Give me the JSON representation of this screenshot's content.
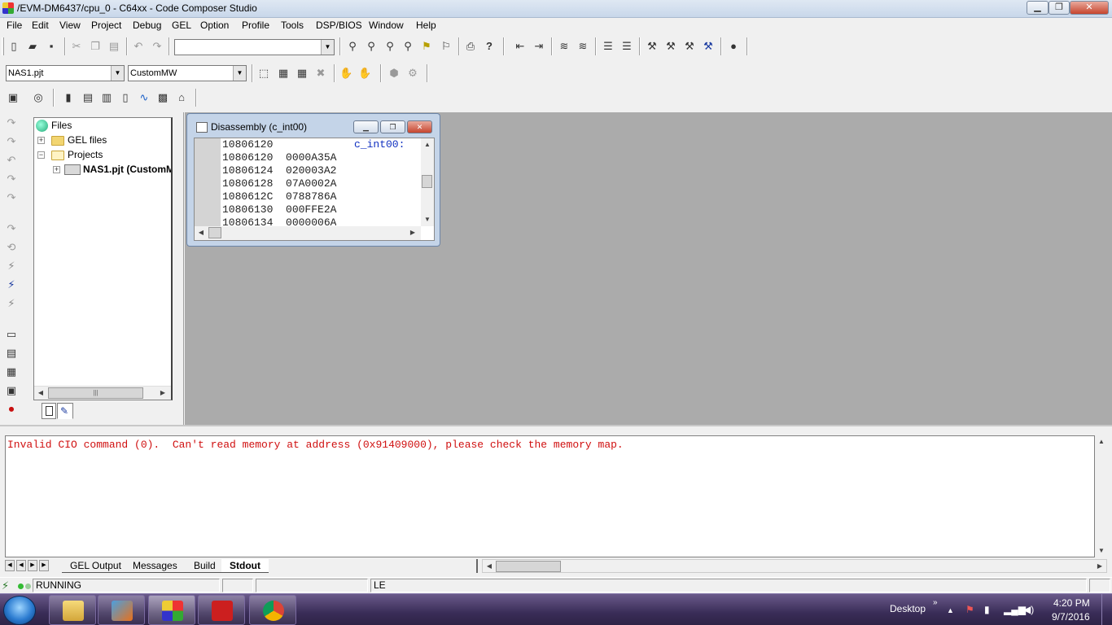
{
  "window": {
    "title": "/EVM-DM6437/cpu_0 - C64xx - Code Composer Studio",
    "min_label": "▁",
    "max_label": "❐",
    "close_label": "✕"
  },
  "menu": {
    "items": [
      "File",
      "Edit",
      "View",
      "Project",
      "Debug",
      "GEL",
      "Option",
      "Profile",
      "Tools",
      "DSP/BIOS",
      "Window",
      "Help"
    ]
  },
  "toolbar": {
    "find_combo_value": "",
    "project_combo_value": "NAS1.pjt",
    "config_combo_value": "CustomMW"
  },
  "project_tree": {
    "root_label": "Files",
    "gel_label": "GEL files",
    "projects_label": "Projects",
    "project_item_label": "NAS1.pjt (CustomM"
  },
  "disassembly": {
    "title": "Disassembly (c_int00)",
    "label": "c_int00:",
    "lines": [
      "10806120",
      "10806120  0000A35A",
      "10806124  020003A2",
      "10806128  07A0002A",
      "1080612C  0788786A",
      "10806130  000FFE2A",
      "10806134  0000006A"
    ]
  },
  "output": {
    "message": "Invalid CIO command (0).  Can't read memory at address (0x91409000), please check the memory map.",
    "tabs": [
      "GEL Output",
      "Messages",
      "Build",
      "Stdout"
    ],
    "active_tab": "Stdout"
  },
  "status": {
    "state": "RUNNING",
    "endian": "LE"
  },
  "taskbar": {
    "desktop_label": "Desktop",
    "time": "4:20 PM",
    "date": "9/7/2016",
    "apps": [
      "file-explorer",
      "matlab",
      "code-composer",
      "acrobat",
      "chrome"
    ],
    "colors": {
      "matlab": "#e8701a",
      "acrobat": "#cc1f1f",
      "chrome": "#4285f4"
    }
  }
}
